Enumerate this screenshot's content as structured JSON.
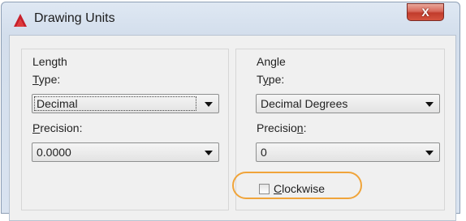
{
  "window": {
    "title": "Drawing Units",
    "close_glyph": "X",
    "logo_icon": "autocad-logo-icon",
    "close_button_color": "#c8473a"
  },
  "length": {
    "group_label": "Length",
    "type_label": "Type:",
    "type_value": "Decimal",
    "precision_label": "Precision:",
    "precision_value": "0.0000"
  },
  "angle": {
    "group_label": "Angle",
    "type_label": "Type:",
    "type_value": "Decimal Degrees",
    "precision_label": "Precision:",
    "precision_value": "0",
    "clockwise_label": "Clockwise",
    "clockwise_checked": false
  },
  "annotation": {
    "highlight_color": "#f0a43a"
  }
}
